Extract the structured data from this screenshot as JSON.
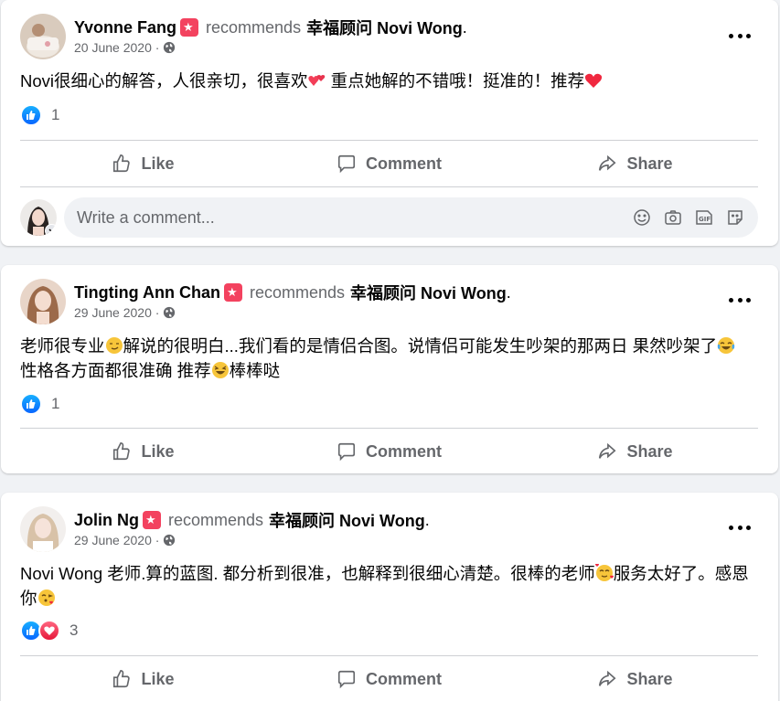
{
  "colors": {
    "accent": "#0866ff",
    "recommend": "#f3425f",
    "love": "#f33e58",
    "muted": "#65676b"
  },
  "actions": {
    "like": "Like",
    "comment": "Comment",
    "share": "Share"
  },
  "comment_placeholder": "Write a comment...",
  "posts": [
    {
      "author": "Yvonne Fang",
      "recommends": "recommends",
      "page": "幸福顾问 Novi Wong",
      "period": ".",
      "date": "20 June 2020 ·",
      "text_parts": [
        "Novi很细心的解答，人很亲切，很喜欢",
        " 重点她解的不错哦！挺准的！推荐",
        ""
      ],
      "reaction_count": "1"
    },
    {
      "author": "Tingting Ann Chan",
      "recommends": "recommends",
      "page": "幸福顾问 Novi Wong",
      "period": ".",
      "date": "29 June 2020 ·",
      "text_parts": [
        "老师很专业",
        "解说的很明白...我们看的是情侣合图。说情侣可能发生吵架的那两日 果然吵架了",
        "性格各方面都很准确 推荐",
        "棒棒哒"
      ],
      "reaction_count": "1"
    },
    {
      "author": "Jolin Ng",
      "recommends": "recommends",
      "page": "幸福顾问 Novi Wong",
      "period": ".",
      "date": "29 June 2020 ·",
      "text_parts": [
        "Novi Wong 老师.算的蓝图. 都分析到很准，也解释到很细心清楚。很棒的老师",
        "服务太好了。感恩你",
        ""
      ],
      "reaction_count": "3"
    }
  ]
}
